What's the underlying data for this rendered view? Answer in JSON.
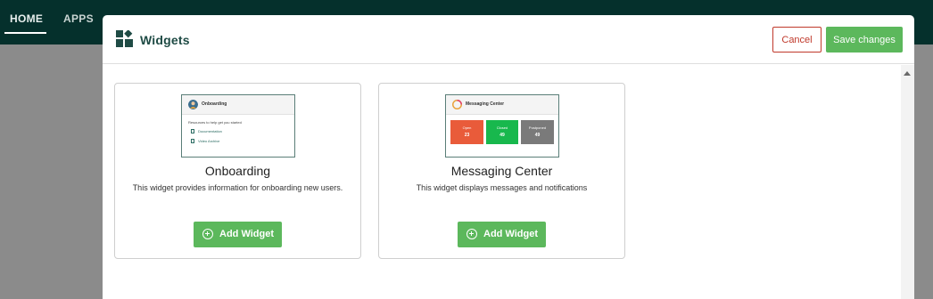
{
  "nav": {
    "home": "HOME",
    "apps": "APPS"
  },
  "modal": {
    "title": "Widgets",
    "cancel_label": "Cancel",
    "save_label": "Save changes"
  },
  "widgets": [
    {
      "title": "Onboarding",
      "description": "This widget provides information for onboarding new users.",
      "add_label": "Add Widget",
      "preview": {
        "title": "Onboarding",
        "text": "Resources to help get you started",
        "links": [
          "Documentation",
          "Video Archive"
        ]
      }
    },
    {
      "title": "Messaging Center",
      "description": "This widget displays messages and notifications",
      "add_label": "Add Widget",
      "preview": {
        "title": "Messaging Center",
        "boxes": [
          {
            "label": "Open",
            "value": "23",
            "color": "#e95b3a"
          },
          {
            "label": "Closed",
            "value": "49",
            "color": "#18b84d"
          },
          {
            "label": "Postponed",
            "value": "49",
            "color": "#7a7a7a"
          }
        ]
      }
    }
  ],
  "colors": {
    "topbar": "#05302c",
    "accent_green": "#5cb85c",
    "cancel_red": "#c0392b",
    "title_teal": "#1f4b45"
  }
}
